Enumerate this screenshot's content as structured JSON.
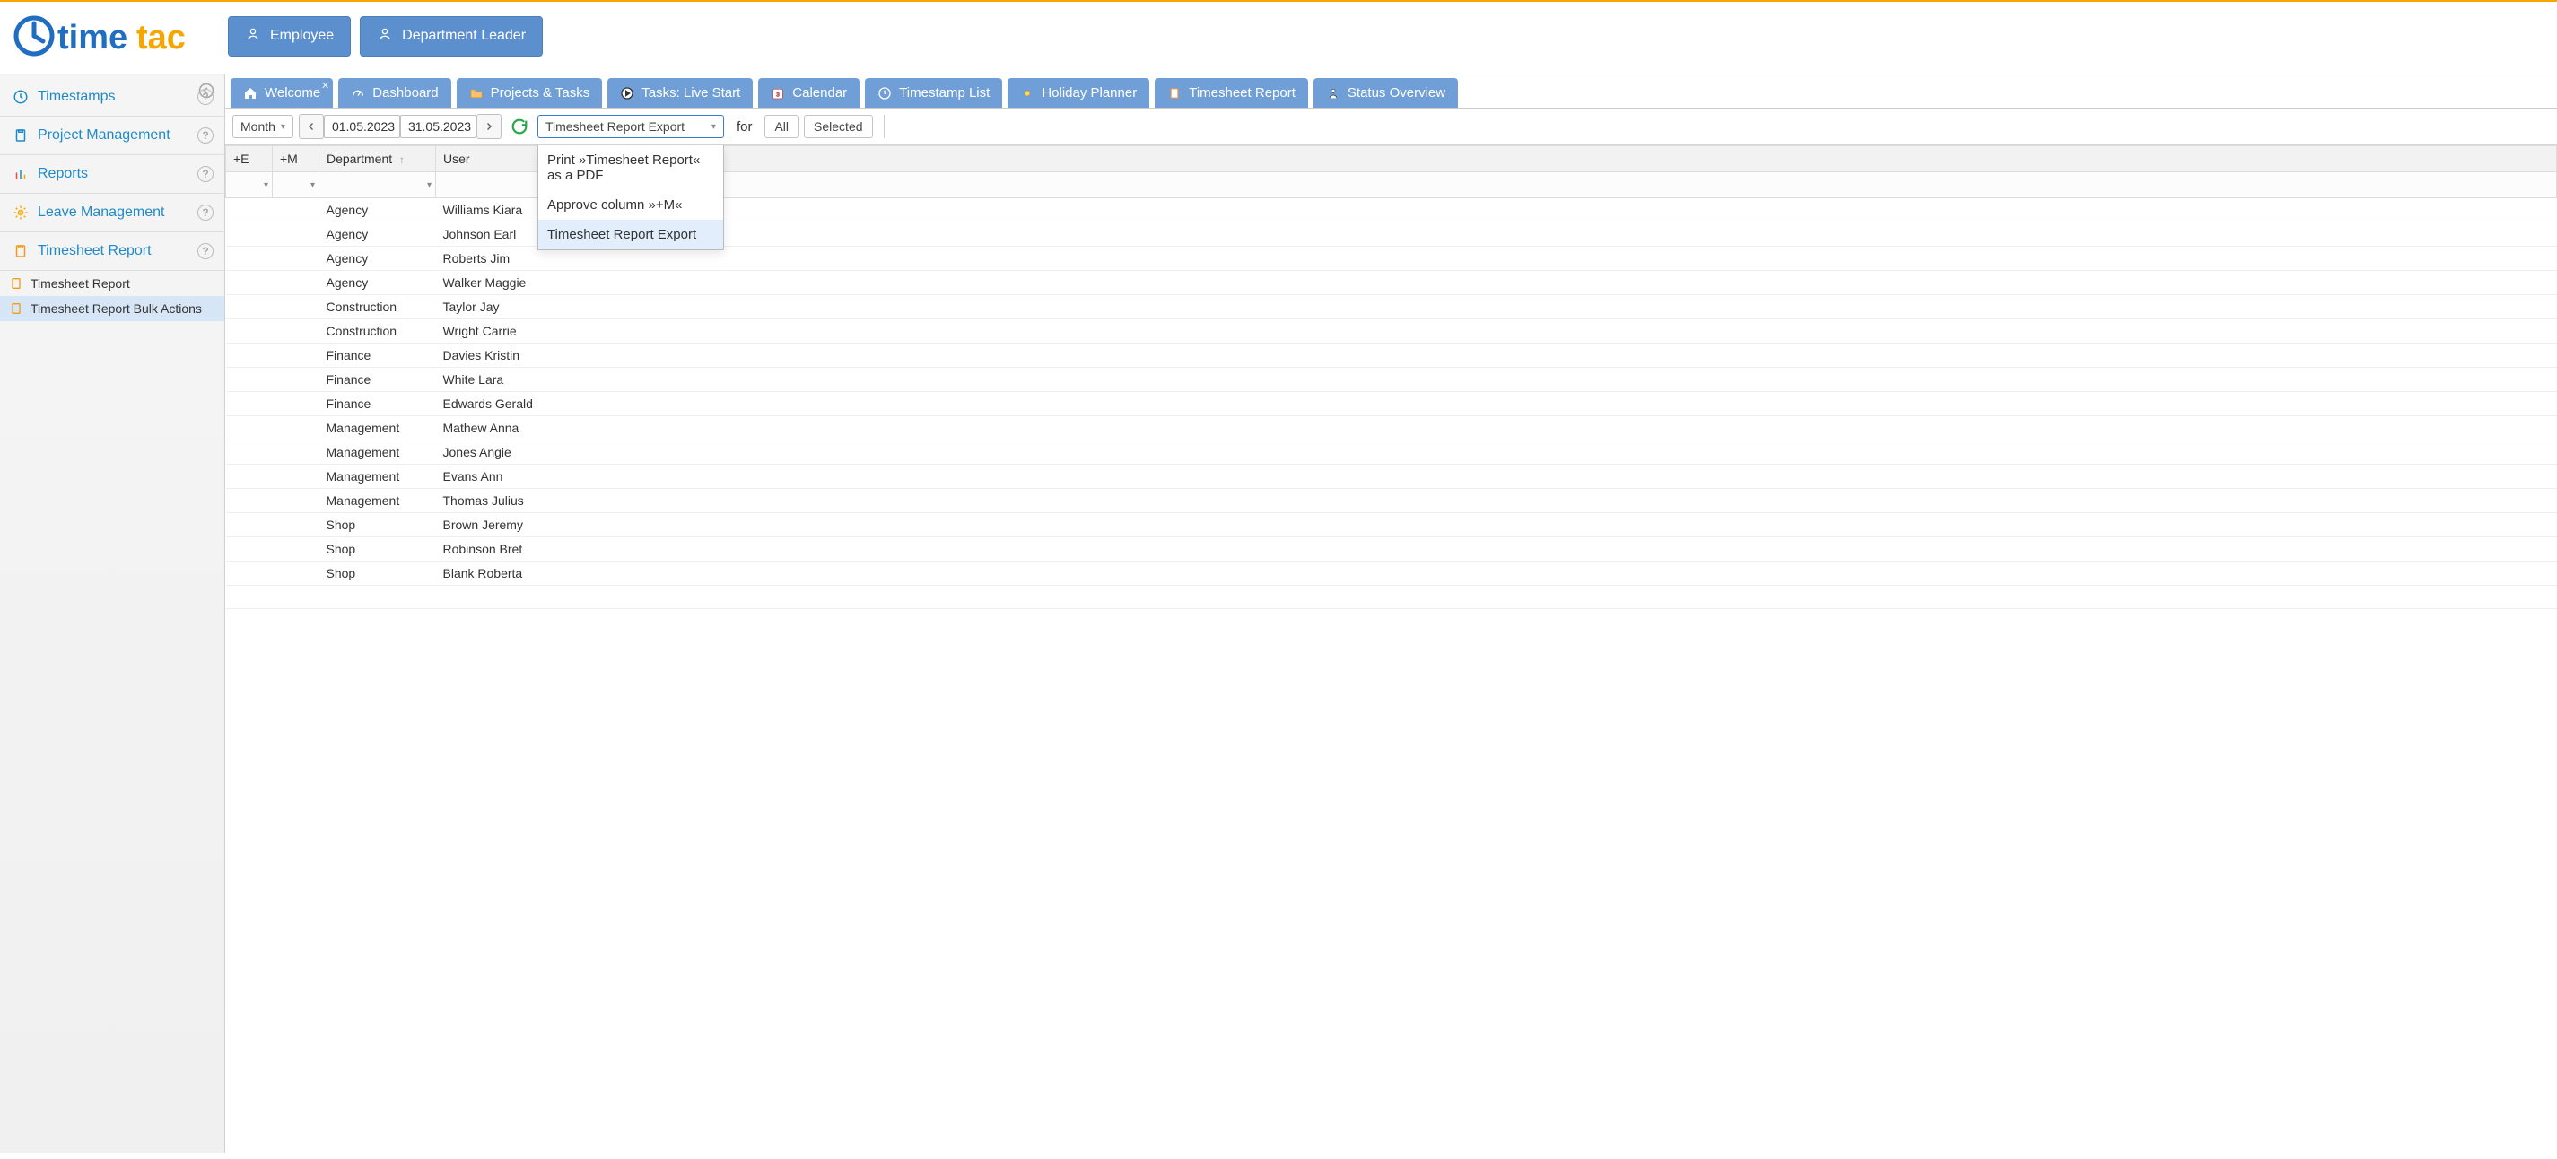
{
  "colors": {
    "accent": "#5b8fce",
    "brand_orange": "#f7a600",
    "brand_blue": "#1f6ec2"
  },
  "logo": {
    "text1": "time",
    "text2": "tac"
  },
  "roles": [
    {
      "key": "employee",
      "label": "Employee"
    },
    {
      "key": "dept-leader",
      "label": "Department Leader"
    }
  ],
  "sidebar": {
    "groups": [
      {
        "key": "timestamps",
        "label": "Timestamps",
        "icon": "clock"
      },
      {
        "key": "project-mgmt",
        "label": "Project Management",
        "icon": "clipboard"
      },
      {
        "key": "reports",
        "label": "Reports",
        "icon": "bars"
      },
      {
        "key": "leave",
        "label": "Leave Management",
        "icon": "sun"
      },
      {
        "key": "timesheet",
        "label": "Timesheet Report",
        "icon": "clipboard2",
        "expanded": true,
        "subitems": [
          {
            "key": "timesheet-report",
            "label": "Timesheet Report"
          },
          {
            "key": "timesheet-bulk",
            "label": "Timesheet Report Bulk Actions",
            "active": true
          }
        ]
      }
    ]
  },
  "tabs": [
    {
      "key": "welcome",
      "label": "Welcome",
      "icon": "home",
      "closable": true
    },
    {
      "key": "dashboard",
      "label": "Dashboard",
      "icon": "speedo"
    },
    {
      "key": "projects",
      "label": "Projects & Tasks",
      "icon": "folder"
    },
    {
      "key": "live",
      "label": "Tasks: Live Start",
      "icon": "play"
    },
    {
      "key": "calendar",
      "label": "Calendar",
      "icon": "cal"
    },
    {
      "key": "tslist",
      "label": "Timestamp List",
      "icon": "clock"
    },
    {
      "key": "holiday",
      "label": "Holiday Planner",
      "icon": "sun"
    },
    {
      "key": "tsreport",
      "label": "Timesheet Report",
      "icon": "clipboard2"
    },
    {
      "key": "status",
      "label": "Status Overview",
      "icon": "person"
    }
  ],
  "toolbar": {
    "period_label": "Month",
    "date_from": "01.05.2023",
    "date_to": "31.05.2023",
    "export_select": "Timesheet Report Export",
    "for_label": "for",
    "all_label": "All",
    "selected_label": "Selected",
    "dropdown_items": [
      "Print »Timesheet Report« as a PDF",
      "Approve column »+M«",
      "Timesheet Report Export"
    ],
    "dropdown_highlight_index": 2
  },
  "table": {
    "columns": [
      {
        "key": "e",
        "label": "+E"
      },
      {
        "key": "m",
        "label": "+M"
      },
      {
        "key": "dept",
        "label": "Department",
        "sort": "asc"
      },
      {
        "key": "user",
        "label": "User"
      }
    ],
    "rows": [
      {
        "dept": "Agency",
        "user": "Williams Kiara"
      },
      {
        "dept": "Agency",
        "user": "Johnson Earl"
      },
      {
        "dept": "Agency",
        "user": "Roberts Jim"
      },
      {
        "dept": "Agency",
        "user": "Walker Maggie"
      },
      {
        "dept": "Construction",
        "user": "Taylor Jay"
      },
      {
        "dept": "Construction",
        "user": "Wright Carrie"
      },
      {
        "dept": "Finance",
        "user": "Davies Kristin"
      },
      {
        "dept": "Finance",
        "user": "White Lara"
      },
      {
        "dept": "Finance",
        "user": "Edwards Gerald"
      },
      {
        "dept": "Management",
        "user": "Mathew Anna"
      },
      {
        "dept": "Management",
        "user": "Jones Angie"
      },
      {
        "dept": "Management",
        "user": "Evans Ann"
      },
      {
        "dept": "Management",
        "user": "Thomas Julius"
      },
      {
        "dept": "Shop",
        "user": "Brown Jeremy"
      },
      {
        "dept": "Shop",
        "user": "Robinson Bret"
      },
      {
        "dept": "Shop",
        "user": "Blank Roberta"
      }
    ]
  }
}
